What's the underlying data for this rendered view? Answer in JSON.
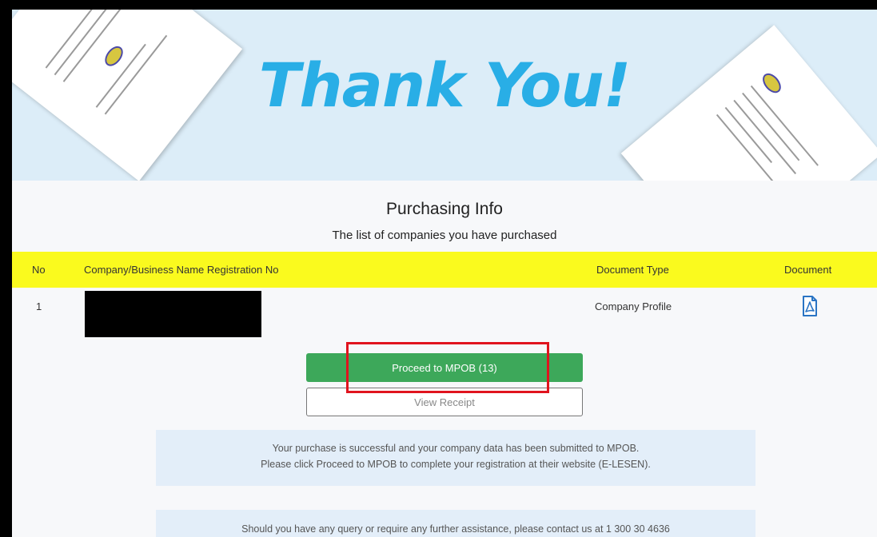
{
  "banner": {
    "title": "Thank You!"
  },
  "purchase": {
    "title": "Purchasing Info",
    "subtitle": "The list of companies you have purchased",
    "columns": {
      "no": "No",
      "company": "Company/Business Name Registration No",
      "doc_type": "Document Type",
      "document": "Document"
    },
    "rows": [
      {
        "no": "1",
        "document_type": "Company Profile",
        "document_icon": "pdf-icon"
      }
    ]
  },
  "actions": {
    "proceed_label": "Proceed to MPOB (13)",
    "receipt_label": "View Receipt"
  },
  "notices": {
    "success_line1": "Your purchase is successful and your company data has been submitted to MPOB.",
    "success_line2": "Please click Proceed to MPOB to complete your registration at their website (E-LESEN).",
    "contact": "Should you have any query or require any further assistance, please contact us at 1 300 30 4636"
  },
  "colors": {
    "banner_bg": "#dcedf8",
    "title_blue": "#29aee6",
    "header_yellow": "#fafa1e",
    "proceed_green": "#3da85a",
    "highlight_red": "#e0141e",
    "notice_bg": "#e3eef9"
  }
}
